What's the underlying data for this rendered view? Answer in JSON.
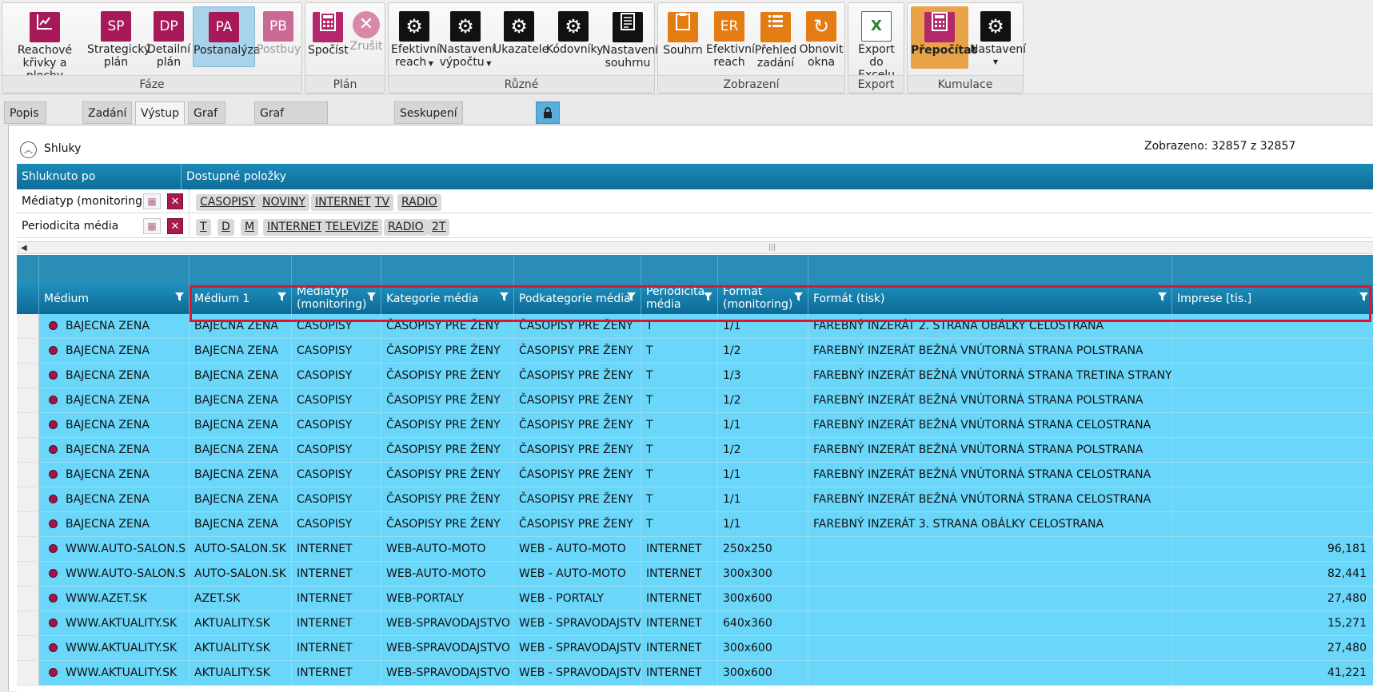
{
  "ribbon": {
    "groups": [
      {
        "title": "Fáze"
      },
      {
        "title": "Plán"
      },
      {
        "title": "Různé"
      },
      {
        "title": "Zobrazení"
      },
      {
        "title": "Export"
      },
      {
        "title": "Kumulace"
      }
    ],
    "faze": {
      "reach": {
        "line1": "Reachové",
        "line2": "křivky a plochy"
      },
      "sp": {
        "icon": "SP",
        "line1": "Strategický",
        "line2": "plán"
      },
      "dp": {
        "icon": "DP",
        "line1": "Detailní",
        "line2": "plán"
      },
      "pa": {
        "icon": "PA",
        "line1": "Postanalýza"
      },
      "pb": {
        "icon": "PB",
        "line1": "Postbuy"
      }
    },
    "plan": {
      "spocist": "Spočíst",
      "zrusit": "Zrušit"
    },
    "ruzne": {
      "efreach": {
        "line1": "Efektivní",
        "line2": "reach"
      },
      "nastvyp": {
        "line1": "Nastavení",
        "line2": "výpočtu"
      },
      "ukaz": "Ukazatele",
      "kodov": "Kódovníky",
      "nastsouh": {
        "line1": "Nastavení",
        "line2": "souhrnu"
      }
    },
    "zobrazeni": {
      "souhrn": "Souhrn",
      "er": {
        "icon": "ER",
        "line1": "Efektivní",
        "line2": "reach"
      },
      "prehled": {
        "line1": "Přehled",
        "line2": "zadání"
      },
      "obnovit": {
        "line1": "Obnovit",
        "line2": "okna"
      }
    },
    "export": {
      "line1": "Export",
      "line2": "do Excelu"
    },
    "kumulace": {
      "prepocitat": "Přepočítat",
      "nastaveni": "Nastavení"
    }
  },
  "tabs": [
    "Popis plánu",
    "Zadání",
    "Výstup",
    "Graf ceny",
    "Graf efektivního reache",
    "Seskupení dle ukazatelů"
  ],
  "panel": {
    "title": "Shluky",
    "shown": "Zobrazeno: 32857 z 32857",
    "cluster_headers": {
      "by": "Shluknuto po",
      "available": "Dostupné položky"
    },
    "clusters": [
      {
        "name": "Médiatyp (monitoring)",
        "chips": [
          "CASOPISY",
          "NOVINY",
          "INTERNET",
          "TV",
          "RADIO"
        ]
      },
      {
        "name": "Periodicita média",
        "chips": [
          "T",
          "D",
          "M",
          "INTERNET",
          "TELEVIZE",
          "RADIO",
          "2T"
        ]
      }
    ]
  },
  "grid": {
    "columns": [
      {
        "l1": "Médium",
        "l2": ""
      },
      {
        "l1": "Médium 1",
        "l2": ""
      },
      {
        "l1": "Médiatyp",
        "l2": "(monitoring)"
      },
      {
        "l1": "Kategorie média",
        "l2": ""
      },
      {
        "l1": "Podkategorie média",
        "l2": ""
      },
      {
        "l1": "Periodicita",
        "l2": "média"
      },
      {
        "l1": "Formát",
        "l2": "(monitoring)"
      },
      {
        "l1": "Formát (tisk)",
        "l2": ""
      },
      {
        "l1": "Imprese [tis.]",
        "l2": ""
      }
    ],
    "rows": [
      [
        "BAJECNA ZENA",
        "BAJECNA ZENA",
        "CASOPISY",
        "ČASOPISY PRE ŽENY",
        "ČASOPISY PRE ŽENY",
        "T",
        "1/1",
        "FAREBNÝ INZERÁT 2. STRANA OBÁLKY CELOSTRANA",
        ""
      ],
      [
        "BAJECNA ZENA",
        "BAJECNA ZENA",
        "CASOPISY",
        "ČASOPISY PRE ŽENY",
        "ČASOPISY PRE ŽENY",
        "T",
        "1/2",
        "FAREBNÝ INZERÁT BEŽNÁ VNÚTORNÁ STRANA POLSTRANA",
        ""
      ],
      [
        "BAJECNA ZENA",
        "BAJECNA ZENA",
        "CASOPISY",
        "ČASOPISY PRE ŽENY",
        "ČASOPISY PRE ŽENY",
        "T",
        "1/3",
        "FAREBNÝ INZERÁT BEŽNÁ VNÚTORNÁ STRANA TRETINA STRANY",
        ""
      ],
      [
        "BAJECNA ZENA",
        "BAJECNA ZENA",
        "CASOPISY",
        "ČASOPISY PRE ŽENY",
        "ČASOPISY PRE ŽENY",
        "T",
        "1/2",
        "FAREBNÝ INZERÁT BEŽNÁ VNÚTORNÁ STRANA POLSTRANA",
        ""
      ],
      [
        "BAJECNA ZENA",
        "BAJECNA ZENA",
        "CASOPISY",
        "ČASOPISY PRE ŽENY",
        "ČASOPISY PRE ŽENY",
        "T",
        "1/1",
        "FAREBNÝ INZERÁT BEŽNÁ VNÚTORNÁ STRANA CELOSTRANA",
        ""
      ],
      [
        "BAJECNA ZENA",
        "BAJECNA ZENA",
        "CASOPISY",
        "ČASOPISY PRE ŽENY",
        "ČASOPISY PRE ŽENY",
        "T",
        "1/2",
        "FAREBNÝ INZERÁT BEŽNÁ VNÚTORNÁ STRANA POLSTRANA",
        ""
      ],
      [
        "BAJECNA ZENA",
        "BAJECNA ZENA",
        "CASOPISY",
        "ČASOPISY PRE ŽENY",
        "ČASOPISY PRE ŽENY",
        "T",
        "1/1",
        "FAREBNÝ INZERÁT BEŽNÁ VNÚTORNÁ STRANA CELOSTRANA",
        ""
      ],
      [
        "BAJECNA ZENA",
        "BAJECNA ZENA",
        "CASOPISY",
        "ČASOPISY PRE ŽENY",
        "ČASOPISY PRE ŽENY",
        "T",
        "1/1",
        "FAREBNÝ INZERÁT BEŽNÁ VNÚTORNÁ STRANA CELOSTRANA",
        ""
      ],
      [
        "BAJECNA ZENA",
        "BAJECNA ZENA",
        "CASOPISY",
        "ČASOPISY PRE ŽENY",
        "ČASOPISY PRE ŽENY",
        "T",
        "1/1",
        "FAREBNÝ INZERÁT 3. STRANA OBÁLKY CELOSTRANA",
        ""
      ],
      [
        "WWW.AUTO-SALON.S",
        "AUTO-SALON.SK",
        "INTERNET",
        "WEB-AUTO-MOTO",
        "WEB - AUTO-MOTO",
        "INTERNET",
        "250x250",
        "",
        "96,181"
      ],
      [
        "WWW.AUTO-SALON.S",
        "AUTO-SALON.SK",
        "INTERNET",
        "WEB-AUTO-MOTO",
        "WEB - AUTO-MOTO",
        "INTERNET",
        "300x300",
        "",
        "82,441"
      ],
      [
        "WWW.AZET.SK",
        "AZET.SK",
        "INTERNET",
        "WEB-PORTALY",
        "WEB - PORTALY",
        "INTERNET",
        "300x600",
        "",
        "27,480"
      ],
      [
        "WWW.AKTUALITY.SK",
        "AKTUALITY.SK",
        "INTERNET",
        "WEB-SPRAVODAJSTVO",
        "WEB - SPRAVODAJSTVO",
        "INTERNET",
        "640x360",
        "",
        "15,271"
      ],
      [
        "WWW.AKTUALITY.SK",
        "AKTUALITY.SK",
        "INTERNET",
        "WEB-SPRAVODAJSTVO",
        "WEB - SPRAVODAJSTVO",
        "INTERNET",
        "300x600",
        "",
        "27,480"
      ],
      [
        "WWW.AKTUALITY.SK",
        "AKTUALITY.SK",
        "INTERNET",
        "WEB-SPRAVODAJSTVO",
        "WEB - SPRAVODAJSTVO",
        "INTERNET",
        "300x600",
        "",
        "41,221"
      ]
    ]
  }
}
